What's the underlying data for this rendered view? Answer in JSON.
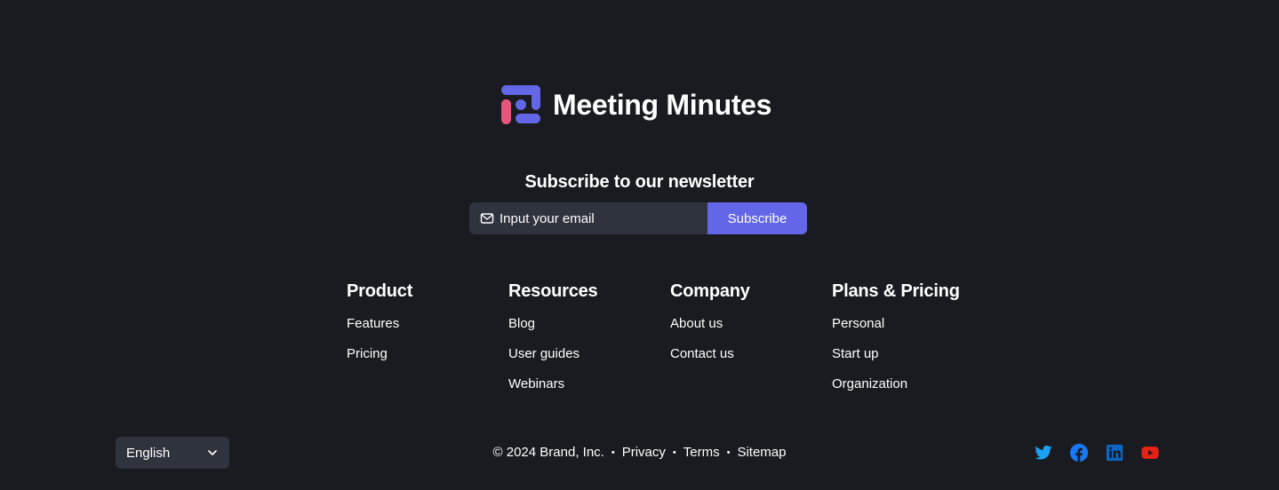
{
  "brand": {
    "name": "Meeting Minutes",
    "colors": {
      "primary": "#6366e6",
      "accent": "#e8557a"
    }
  },
  "newsletter": {
    "title": "Subscribe to our newsletter",
    "email_placeholder": "Input your email",
    "email_value": "",
    "button_label": "Subscribe"
  },
  "columns": [
    {
      "title": "Product",
      "links": [
        "Features",
        "Pricing"
      ]
    },
    {
      "title": "Resources",
      "links": [
        "Blog",
        "User guides",
        "Webinars"
      ]
    },
    {
      "title": "Company",
      "links": [
        "About us",
        "Contact us"
      ]
    },
    {
      "title": "Plans & Pricing",
      "links": [
        "Personal",
        "Start up",
        "Organization"
      ]
    }
  ],
  "language": {
    "selected": "English",
    "icon": "chevron-down-icon"
  },
  "legal": {
    "copyright": "© 2024 Brand, Inc.",
    "separator": "•",
    "links": [
      "Privacy",
      "Terms",
      "Sitemap"
    ]
  },
  "socials": [
    {
      "icon": "twitter-icon",
      "color": "#1da1f2"
    },
    {
      "icon": "facebook-icon",
      "color": "#1877f2"
    },
    {
      "icon": "linkedin-icon",
      "color": "#0a66c2"
    },
    {
      "icon": "youtube-icon",
      "color": "#e62117"
    }
  ],
  "theme": {
    "background": "#191b20",
    "field_background": "#2f333d",
    "text": "#ffffff"
  }
}
